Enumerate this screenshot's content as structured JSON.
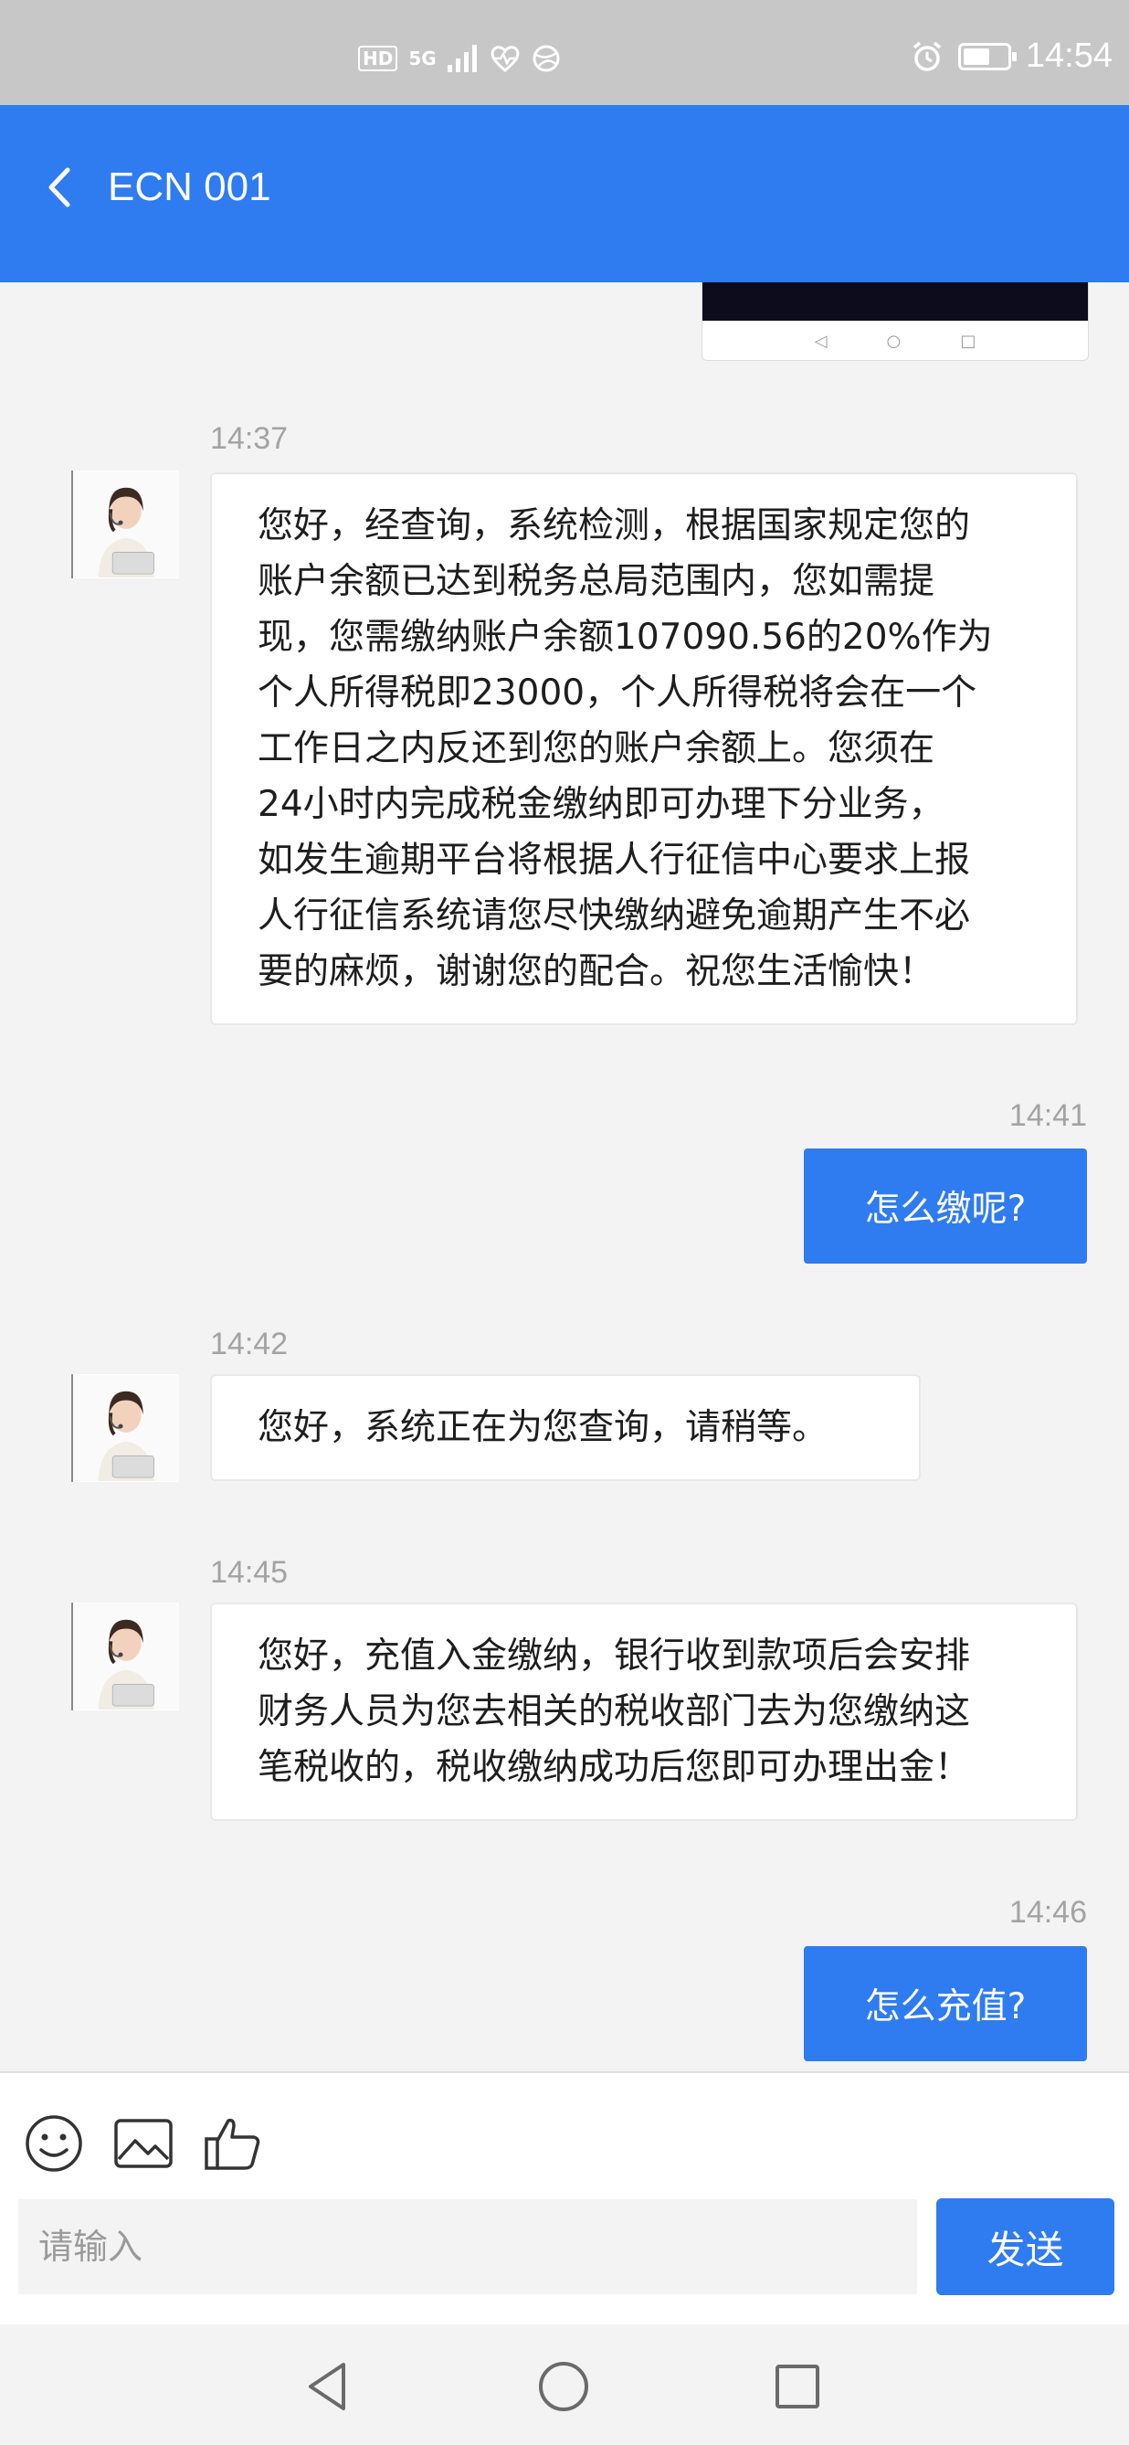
{
  "status_bar": {
    "hd": "HD",
    "signal": "5G",
    "time": "14:54",
    "battery_level": 0.6
  },
  "header": {
    "title": "ECN 001",
    "back_icon": "chevron-left-icon",
    "background": "#2f7bf0"
  },
  "messages": [
    {
      "direction": "in",
      "time": "14:37",
      "lines": [
        "您好，经查询，系统检测，根据国家规定您的",
        "账户余额已达到税务总局范围内，您如需提",
        "现，您需缴纳账户余额107090.56的20%作为",
        "个人所得税即23000，个人所得税将会在一个",
        "工作日之内反还到您的账户余额上。您须在",
        "24小时内完成税金缴纳即可办理下分业务，",
        "如发生逾期平台将根据人行征信中心要求上报",
        "人行征信系统请您尽快缴纳避免逾期产生不必",
        "要的麻烦，谢谢您的配合。祝您生活愉快！"
      ]
    },
    {
      "direction": "out",
      "time": "14:41",
      "text": "怎么缴呢?"
    },
    {
      "direction": "in",
      "time": "14:42",
      "lines": [
        "您好，系统正在为您查询，请稍等。"
      ]
    },
    {
      "direction": "in",
      "time": "14:45",
      "lines": [
        "您好，充值入金缴纳，银行收到款项后会安排",
        "财务人员为您去相关的税收部门去为您缴纳这",
        "笔税收的，税收缴纳成功后您即可办理出金！"
      ]
    },
    {
      "direction": "out",
      "time": "14:46",
      "text": "怎么充值?"
    }
  ],
  "toolbar": {
    "icons": [
      "emoji-icon",
      "image-icon",
      "thumbs-up-icon"
    ]
  },
  "composer": {
    "placeholder": "请输入",
    "value": "",
    "send_label": "发送"
  },
  "nav_bar": {
    "icons": [
      "back-triangle-icon",
      "home-circle-icon",
      "recents-square-icon"
    ]
  },
  "colors": {
    "accent": "#2f7bf0",
    "chat_background": "#f3f3f3",
    "status_bar": "#c7c7c7"
  }
}
